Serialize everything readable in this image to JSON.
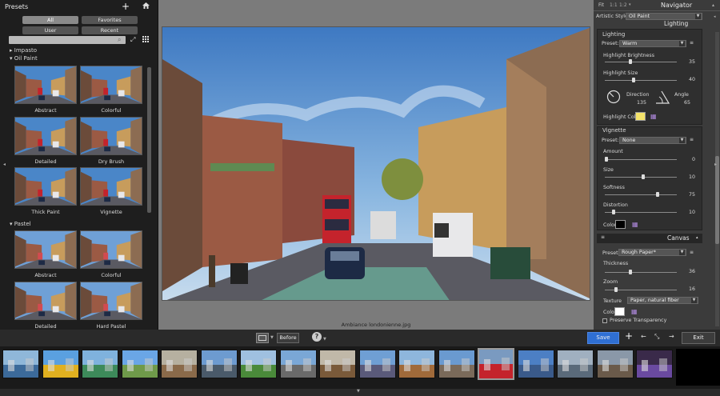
{
  "presets": {
    "title": "Presets",
    "filters": [
      "All",
      "Favorites",
      "User",
      "Recent"
    ],
    "groups": [
      {
        "name": "Impasto",
        "expanded": false
      },
      {
        "name": "Oil Paint",
        "expanded": true,
        "items": [
          "Abstract",
          "Colorful",
          "Detailed",
          "Dry Brush",
          "Thick Paint",
          "Vignette"
        ]
      },
      {
        "name": "Pastel",
        "expanded": true,
        "items": [
          "Abstract",
          "Colorful",
          "Detailed",
          "Hard Pastel"
        ]
      }
    ]
  },
  "navigator": {
    "zoom_options": [
      "Fit",
      "1:1",
      "1:2"
    ],
    "title": "Navigator",
    "artistic_style_label": "Artistic Style:",
    "artistic_style_value": "Oil Paint"
  },
  "lighting": {
    "header": "Lighting",
    "title": "Lighting",
    "preset_label": "Preset:",
    "preset_value": "Warm",
    "highlight_brightness_label": "Highlight Brightness",
    "highlight_brightness_value": "35",
    "highlight_size_label": "Highlight Size",
    "highlight_size_value": "40",
    "direction_label": "Direction",
    "direction_value": "135",
    "angle_label": "Angle",
    "angle_value": "65",
    "highlight_color_label": "Highlight Color",
    "highlight_color": "#f4e36a"
  },
  "vignette": {
    "title": "Vignette",
    "preset_label": "Preset:",
    "preset_value": "None",
    "amount_label": "Amount",
    "amount_value": "0",
    "size_label": "Size",
    "size_value": "10",
    "softness_label": "Softness",
    "softness_value": "75",
    "distortion_label": "Distortion",
    "distortion_value": "10",
    "color_label": "Color",
    "color": "#000000"
  },
  "canvas": {
    "title": "Canvas",
    "preset_label": "Preset:",
    "preset_value": "Rough Paper*",
    "thickness_label": "Thickness",
    "thickness_value": "36",
    "zoom_label": "Zoom",
    "zoom_value": "16",
    "texture_label": "Texture",
    "texture_value": "Paper, natural fiber",
    "color_label": "Color",
    "color": "#ffffff",
    "preserve_transparency_label": "Preserve Transparency"
  },
  "image": {
    "filename": "Ambiance londonienne.jpg"
  },
  "toolbar": {
    "before_label": "Before",
    "save_label": "Save",
    "exit_label": "Exit",
    "help_icon": "?"
  },
  "filmstrip": {
    "count": 17,
    "selected_index": 12
  },
  "colors": {
    "accent": "#2f6fd3",
    "panel": "#1e1e1e"
  }
}
